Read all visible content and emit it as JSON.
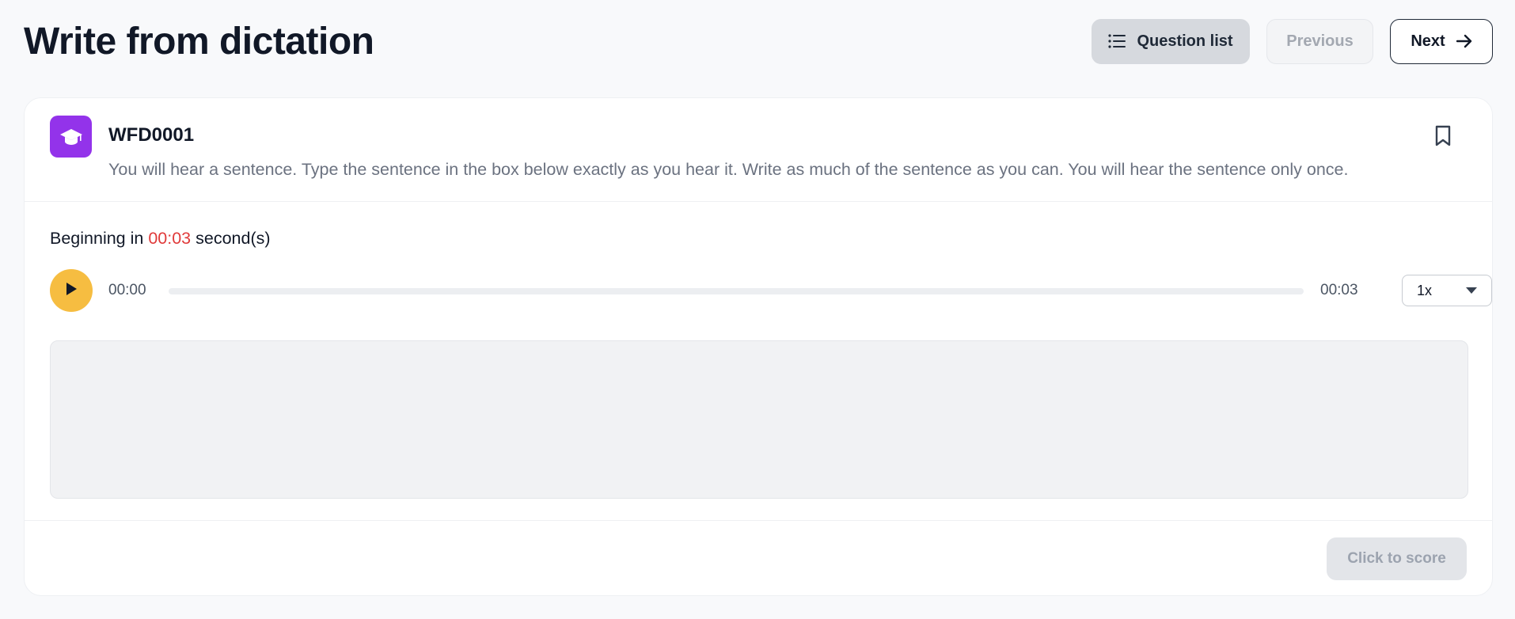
{
  "header": {
    "title": "Write from dictation",
    "question_list_label": "Question list",
    "previous_label": "Previous",
    "next_label": "Next"
  },
  "question": {
    "code": "WFD0001",
    "instruction": "You will hear a sentence. Type the sentence in the box below exactly as you hear it. Write as much of the sentence as you can. You will hear the sentence only once.",
    "bookmarked": false
  },
  "countdown": {
    "prefix": "Beginning in ",
    "time": "00:03",
    "suffix": " second(s)"
  },
  "player": {
    "current_time": "00:00",
    "duration": "00:03",
    "progress": 0,
    "speed": "1x"
  },
  "answer": {
    "value": "",
    "placeholder": ""
  },
  "footer": {
    "score_label": "Click to score"
  },
  "colors": {
    "brand_purple": "#9333ea",
    "play_yellow": "#f6bd41",
    "countdown_red": "#e03a3a"
  },
  "icons": {
    "question_list": "list-icon",
    "next": "arrow-right-icon",
    "badge": "graduation-cap-icon",
    "bookmark": "bookmark-icon",
    "play": "play-icon",
    "speed_dropdown": "caret-down-icon"
  }
}
